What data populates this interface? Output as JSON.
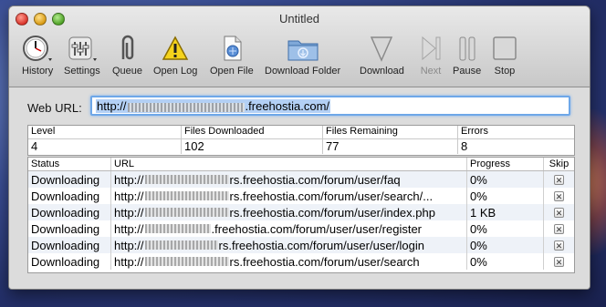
{
  "window": {
    "title": "Untitled"
  },
  "toolbar": {
    "history": "History",
    "settings": "Settings",
    "queue": "Queue",
    "open_log": "Open Log",
    "open_file": "Open File",
    "download_folder": "Download Folder",
    "download": "Download",
    "next": "Next",
    "pause": "Pause",
    "stop": "Stop"
  },
  "url": {
    "label": "Web URL:",
    "prefix": "http://",
    "suffix": ".freehostia.com/"
  },
  "stats": {
    "headers": [
      "Level",
      "Files Downloaded",
      "Files Remaining",
      "Errors"
    ],
    "values": [
      "4",
      "102",
      "77",
      "8"
    ]
  },
  "downloads": {
    "headers": [
      "Status",
      "URL",
      "Progress",
      "Skip"
    ],
    "rows": [
      {
        "status": "Downloading",
        "url_prefix": "http://",
        "url_suffix": "rs.freehostia.com/forum/user/faq",
        "progress": "0%"
      },
      {
        "status": "Downloading",
        "url_prefix": "http://",
        "url_suffix": "rs.freehostia.com/forum/user/search/...",
        "progress": "0%"
      },
      {
        "status": "Downloading",
        "url_prefix": "http://",
        "url_suffix": "rs.freehostia.com/forum/user/index.php",
        "progress": "1 KB"
      },
      {
        "status": "Downloading",
        "url_prefix": "http://",
        "url_suffix": ".freehostia.com/forum/user/user/register",
        "progress": "0%"
      },
      {
        "status": "Downloading",
        "url_prefix": "http://",
        "url_suffix": "rs.freehostia.com/forum/user/user/login",
        "progress": "0%"
      },
      {
        "status": "Downloading",
        "url_prefix": "http://",
        "url_suffix": "rs.freehostia.com/forum/user/search",
        "progress": "0%"
      }
    ],
    "skip_glyph": "✕"
  }
}
